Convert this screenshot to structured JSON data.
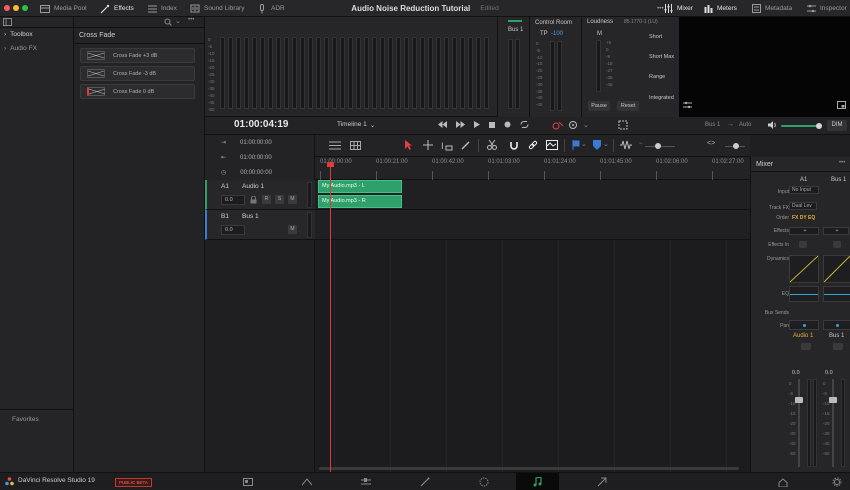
{
  "topbar": {
    "media_pool": "Media Pool",
    "effects": "Effects",
    "index": "Index",
    "sound_library": "Sound Library",
    "adr": "ADR",
    "mixer": "Mixer",
    "meters": "Meters",
    "metadata": "Metadata",
    "inspector": "Inspector"
  },
  "window": {
    "title": "Audio Noise Reduction Tutorial",
    "status": "Edited"
  },
  "toolbox": {
    "toolbox": "Toolbox",
    "audio_fx": "Audio FX",
    "favorites": "Favorites"
  },
  "crossfade": {
    "header": "Cross Fade",
    "items": [
      "Cross Fade +3 dB",
      "Cross Fade -3 dB",
      "Cross Fade 0 dB"
    ]
  },
  "meters_top": {
    "scale": [
      "0",
      "-5",
      "-10",
      "-15",
      "-20",
      "-25",
      "-30",
      "-35",
      "-40",
      "-45",
      "-50"
    ],
    "bus1": "Bus 1",
    "control_room": "Control Room",
    "tp_label": "TP",
    "tp_value": "-100",
    "loudness": "Loudness",
    "loudness_value": "85.1770-1 (LU)",
    "m_label": "M",
    "short": "Short",
    "short_max": "Short Max",
    "range": "Range",
    "integrated": "Integrated",
    "pause": "Pause",
    "reset": "Reset"
  },
  "transport": {
    "timecode": "01:00:04:19",
    "timeline": "Timeline 1",
    "bus": "Bus 1",
    "auto": "Auto",
    "dim": "DIM"
  },
  "timecodes": [
    "01:00:00:00",
    "01:00:00:00",
    "00:00:00:00"
  ],
  "ruler": [
    "01:00:00:00",
    "01:00:21:00",
    "01:00:42:00",
    "01:01:03:00",
    "01:01:24:00",
    "01:01:45:00",
    "01:02:06:00",
    "01:02:27:00"
  ],
  "tracks": [
    {
      "num": "A1",
      "name": "Audio 1",
      "vol": "0.0",
      "buttons": [
        "R",
        "S",
        "M"
      ]
    },
    {
      "num": "B1",
      "name": "Bus 1",
      "vol": "0.0",
      "buttons": [
        "M"
      ]
    }
  ],
  "clips": [
    "My Audio.mp3 - L",
    "My Audio.mp3 - R"
  ],
  "mixer": {
    "header": "Mixer",
    "col1": "A1",
    "col2": "Bus 1",
    "labels": {
      "input": "Input",
      "track_fx": "Track FX",
      "order": "Order",
      "effects": "Effects",
      "effects_in": "Effects In",
      "dynamics": "Dynamics",
      "eq": "EQ",
      "bus_sends": "Bus Sends",
      "pan": "Pan"
    },
    "no_input": "No Input",
    "dual_lev": "Dual Lev",
    "order_value": "FX DY EQ",
    "ch1_name": "Audio 1",
    "ch2_name": "Bus 1",
    "ch1_vol": "0.0",
    "ch2_vol": "0.0",
    "fader_scale": [
      "0",
      "-5",
      "-10",
      "-15",
      "-20",
      "-30",
      "-40",
      "-50"
    ]
  },
  "bottombar": {
    "app": "DaVinci Resolve Studio 19",
    "beta": "PUBLIC BETA"
  },
  "colors": {
    "accent": "#2fa06b",
    "playhead": "#e03a3a",
    "blue": "#3a7bd5",
    "red_tool": "#e04040"
  }
}
